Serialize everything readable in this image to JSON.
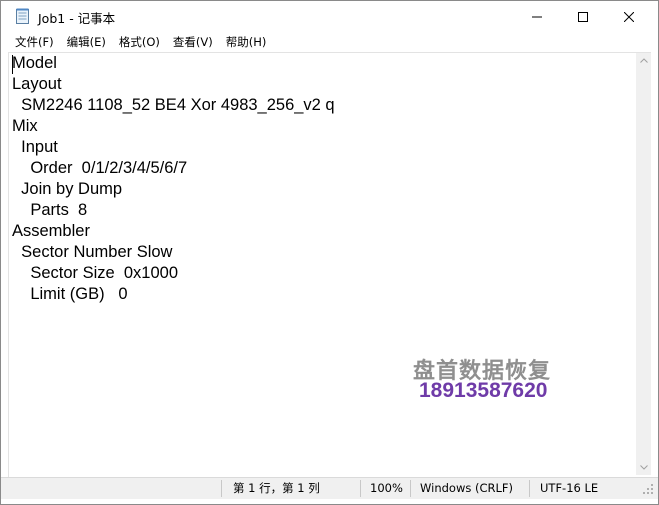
{
  "window": {
    "title": "Job1 - 记事本"
  },
  "menu": {
    "items": [
      {
        "label": "文件(F)"
      },
      {
        "label": "编辑(E)"
      },
      {
        "label": "格式(O)"
      },
      {
        "label": "查看(V)"
      },
      {
        "label": "帮助(H)"
      }
    ]
  },
  "editor": {
    "lines": [
      "Model",
      "Layout",
      "  SM2246 1108_52 BE4 Xor 4983_256_v2 q",
      "Mix",
      "  Input",
      "    Order  0/1/2/3/4/5/6/7",
      "  Join by Dump",
      "    Parts  8",
      "Assembler",
      "  Sector Number Slow",
      "    Sector Size  0x1000",
      "    Limit (GB)   0"
    ]
  },
  "watermark": {
    "line1": "盘首数据恢复",
    "line2": "18913587620"
  },
  "status": {
    "position": "第 1 行，第 1 列",
    "zoom": "100%",
    "line_ending": "Windows (CRLF)",
    "encoding": "UTF-16 LE"
  },
  "icons": {
    "app": "notepad-icon",
    "minimize": "minimize-icon",
    "maximize": "maximize-icon",
    "close": "close-icon"
  },
  "colors": {
    "watermark_gray": "#8f8f8f",
    "watermark_purple": "#6f3ba8",
    "statusbar_bg": "#f0f0f0"
  }
}
